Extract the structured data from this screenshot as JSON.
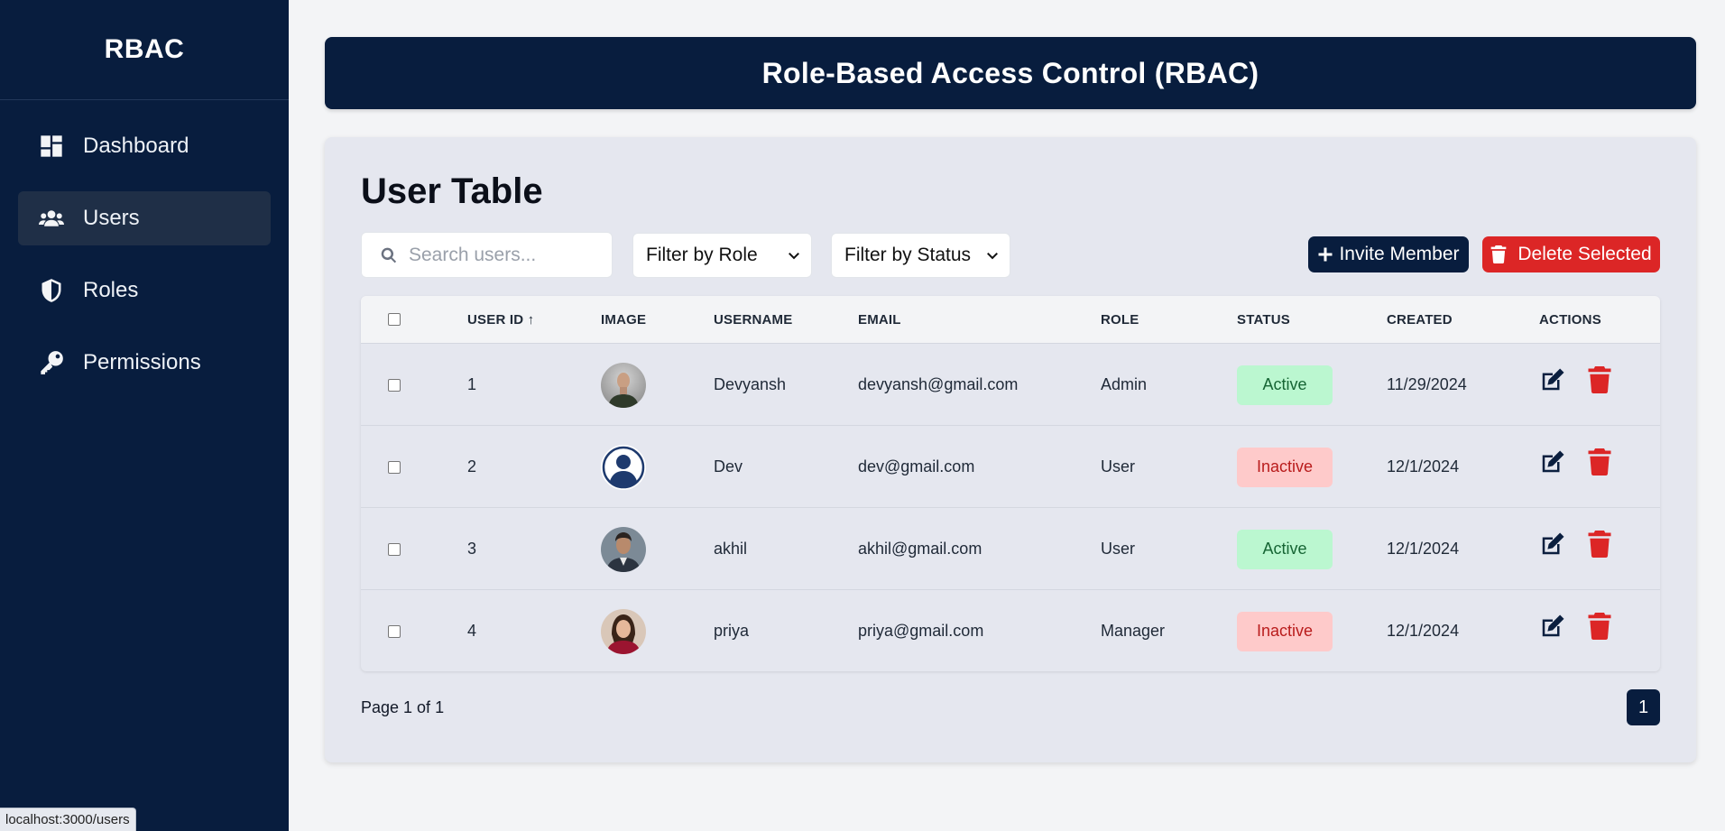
{
  "sidebar": {
    "brand": "RBAC",
    "items": [
      {
        "label": "Dashboard",
        "icon": "dashboard-icon",
        "active": false
      },
      {
        "label": "Users",
        "icon": "users-icon",
        "active": true
      },
      {
        "label": "Roles",
        "icon": "shield-icon",
        "active": false
      },
      {
        "label": "Permissions",
        "icon": "key-icon",
        "active": false
      }
    ]
  },
  "header": {
    "title": "Role-Based Access Control (RBAC)"
  },
  "main": {
    "title": "User Table",
    "search": {
      "placeholder": "Search users..."
    },
    "filter_role": "Filter by Role",
    "filter_status": "Filter by Status",
    "invite_label": "Invite Member",
    "delete_label": "Delete Selected"
  },
  "table": {
    "headers": {
      "user_id": "USER ID ↑",
      "image": "IMAGE",
      "username": "USERNAME",
      "email": "EMAIL",
      "role": "ROLE",
      "status": "STATUS",
      "created": "CREATED",
      "actions": "ACTIONS"
    },
    "rows": [
      {
        "id": "1",
        "username": "Devyansh",
        "email": "devyansh@gmail.com",
        "role": "Admin",
        "status": "Active",
        "created": "11/29/2024"
      },
      {
        "id": "2",
        "username": "Dev",
        "email": "dev@gmail.com",
        "role": "User",
        "status": "Inactive",
        "created": "12/1/2024"
      },
      {
        "id": "3",
        "username": "akhil",
        "email": "akhil@gmail.com",
        "role": "User",
        "status": "Active",
        "created": "12/1/2024"
      },
      {
        "id": "4",
        "username": "priya",
        "email": "priya@gmail.com",
        "role": "Manager",
        "status": "Inactive",
        "created": "12/1/2024"
      }
    ]
  },
  "pagination": {
    "info": "Page 1 of 1",
    "current": "1"
  },
  "statusbar": {
    "url": "localhost:3000/users"
  },
  "colors": {
    "navy": "#081d3e",
    "danger": "#dc2626",
    "active_bg": "#bbf7d0",
    "inactive_bg": "#fecaca"
  }
}
